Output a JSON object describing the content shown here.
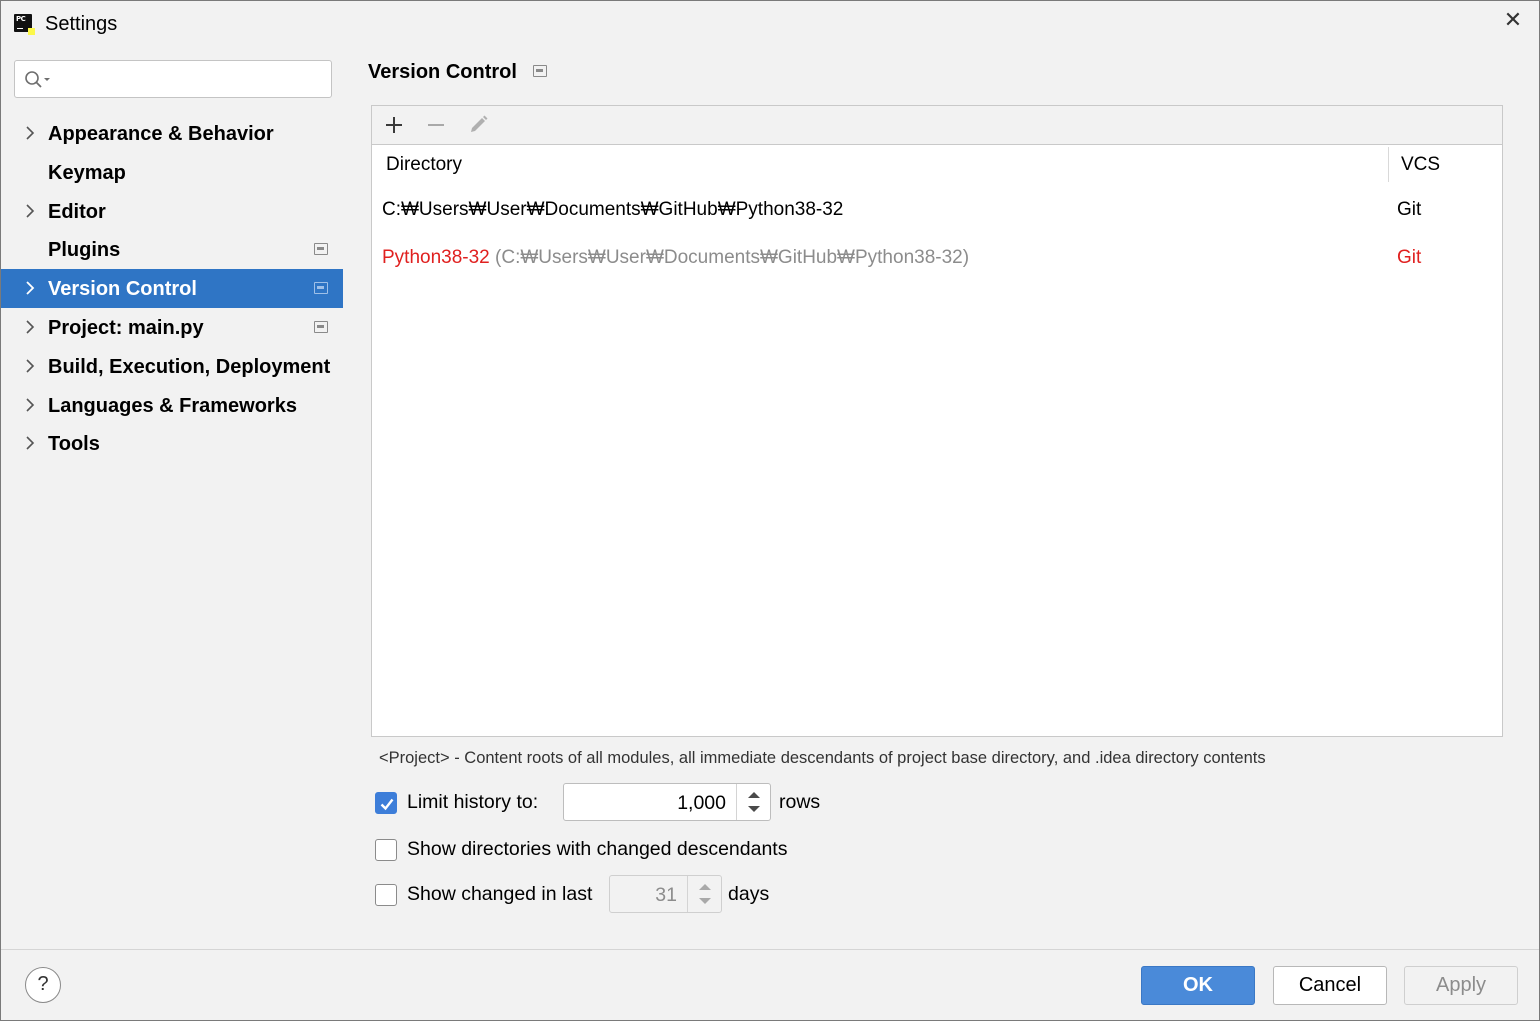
{
  "window": {
    "title": "Settings",
    "app_icon_text": "PC"
  },
  "sidebar": {
    "search": {
      "value": "",
      "placeholder": ""
    },
    "items": [
      {
        "label": "Appearance & Behavior",
        "expandable": true,
        "project_scoped": false,
        "selected": false
      },
      {
        "label": "Keymap",
        "expandable": false,
        "project_scoped": false,
        "selected": false
      },
      {
        "label": "Editor",
        "expandable": true,
        "project_scoped": false,
        "selected": false
      },
      {
        "label": "Plugins",
        "expandable": false,
        "project_scoped": true,
        "selected": false
      },
      {
        "label": "Version Control",
        "expandable": true,
        "project_scoped": true,
        "selected": true
      },
      {
        "label": "Project: main.py",
        "expandable": true,
        "project_scoped": true,
        "selected": false
      },
      {
        "label": "Build, Execution, Deployment",
        "expandable": true,
        "project_scoped": false,
        "selected": false
      },
      {
        "label": "Languages & Frameworks",
        "expandable": true,
        "project_scoped": false,
        "selected": false
      },
      {
        "label": "Tools",
        "expandable": true,
        "project_scoped": false,
        "selected": false
      }
    ]
  },
  "main": {
    "title": "Version Control",
    "toolbar": {
      "add_icon": "plus-icon",
      "remove_icon": "minus-icon",
      "edit_icon": "pencil-icon"
    },
    "table": {
      "columns": [
        "Directory",
        "VCS"
      ],
      "rows": [
        {
          "name": "",
          "directory": "C:₩Users₩User₩Documents₩GitHub₩Python38-32",
          "vcs": "Git",
          "unregistered": false
        },
        {
          "name": "Python38-32",
          "directory": "(C:₩Users₩User₩Documents₩GitHub₩Python38-32)",
          "vcs": "Git",
          "unregistered": true
        }
      ]
    },
    "hint": "<Project> - Content roots of all modules, all immediate descendants of project base directory, and .idea directory contents",
    "options": {
      "limit_history": {
        "label": "Limit history to:",
        "checked": true,
        "value": "1,000",
        "unit": "rows"
      },
      "show_dirs": {
        "label": "Show directories with changed descendants",
        "checked": false
      },
      "show_changed": {
        "label": "Show changed in last",
        "checked": false,
        "value": "31",
        "unit": "days"
      }
    }
  },
  "footer": {
    "help_label": "?",
    "ok_label": "OK",
    "cancel_label": "Cancel",
    "apply_label": "Apply"
  },
  "colors": {
    "selection": "#2f75c5",
    "unregistered_text": "#e0201f",
    "ok_button": "#4a8ad9",
    "checkbox_checked": "#3d7ed9"
  }
}
